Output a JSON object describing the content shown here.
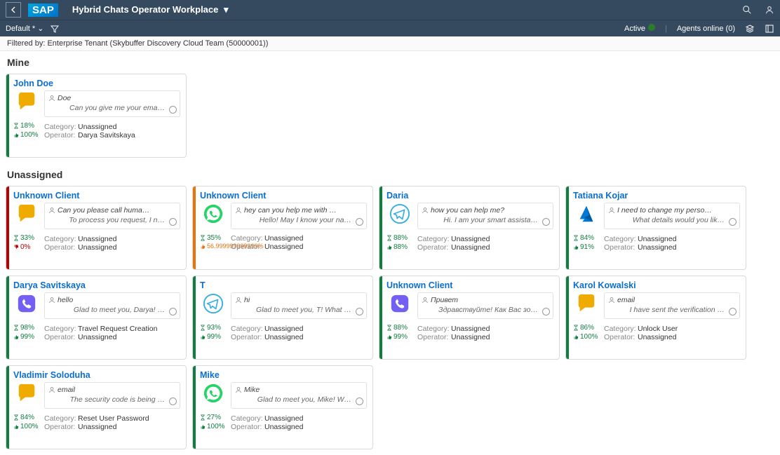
{
  "header": {
    "title": "Hybrid Chats Operator Workplace",
    "logoText": "SAP"
  },
  "subheader": {
    "default": "Default *",
    "activeLabel": "Active",
    "agentsOnline": "Agents online (0)"
  },
  "filter": "Filtered by: Enterprise Tenant (Skybuffer Discovery Cloud Team (50000001))",
  "sections": {
    "mine": "Mine",
    "unassigned": "Unassigned"
  },
  "labels": {
    "category": "Category:",
    "operator": "Operator:"
  },
  "mineCards": [
    {
      "title": "John Doe",
      "channel": "chat",
      "accent": "green",
      "msgUser": "Doe",
      "msgReply": "Can you give me your ema…",
      "timer": "18%",
      "timerClass": "stat-green",
      "thumb": "100%",
      "thumbClass": "stat-green",
      "thumbDir": "up",
      "category": "Unassigned",
      "operator": "Darya Savitskaya"
    }
  ],
  "unassignedCards": [
    {
      "title": "Unknown Client",
      "channel": "chat",
      "accent": "red",
      "msgUser": "Can you please call huma…",
      "msgReply": "To process you request, I n…",
      "timer": "33%",
      "timerClass": "stat-green",
      "thumb": "0%",
      "thumbClass": "stat-red",
      "thumbDir": "down",
      "category": "Unassigned",
      "operator": "Unassigned"
    },
    {
      "title": "Unknown Client",
      "channel": "whatsapp",
      "accent": "orange",
      "msgUser": "hey can you help me with …",
      "msgReply": "Hello! May I know your na…",
      "timer": "35%",
      "timerClass": "stat-green",
      "thumb": "56.999999999999%",
      "thumbClass": "stat-orange",
      "thumbDir": "up",
      "category": "Unassigned",
      "operator": "Unassigned"
    },
    {
      "title": "Daria",
      "channel": "telegram",
      "accent": "green",
      "msgUser": "how you can help me?",
      "msgReply": "Hi. I am your smart assista…",
      "timer": "88%",
      "timerClass": "stat-green",
      "thumb": "88%",
      "thumbClass": "stat-green",
      "thumbDir": "up",
      "category": "Unassigned",
      "operator": "Unassigned"
    },
    {
      "title": "Tatiana Kojar",
      "channel": "azure",
      "accent": "green",
      "msgUser": "I need to change my perso…",
      "msgReply": "What details would you lik…",
      "timer": "84%",
      "timerClass": "stat-green",
      "thumb": "91%",
      "thumbClass": "stat-green",
      "thumbDir": "up",
      "category": "Unassigned",
      "operator": "Unassigned"
    },
    {
      "title": "Darya Savitskaya",
      "channel": "viber",
      "accent": "green",
      "msgUser": "hello",
      "msgReply": "Glad to meet you, Darya! …",
      "timer": "98%",
      "timerClass": "stat-green",
      "thumb": "99%",
      "thumbClass": "stat-green",
      "thumbDir": "up",
      "category": "Travel Request Creation",
      "operator": "Unassigned"
    },
    {
      "title": "T",
      "channel": "telegram",
      "accent": "green",
      "msgUser": "hi",
      "msgReply": "Glad to meet you, T! What …",
      "timer": "93%",
      "timerClass": "stat-green",
      "thumb": "99%",
      "thumbClass": "stat-green",
      "thumbDir": "up",
      "category": "Unassigned",
      "operator": "Unassigned"
    },
    {
      "title": "Unknown Client",
      "channel": "viber",
      "accent": "green",
      "msgUser": "Привет",
      "msgReply": "Здравствуйте! Как Вас зо…",
      "timer": "88%",
      "timerClass": "stat-green",
      "thumb": "99%",
      "thumbClass": "stat-green",
      "thumbDir": "up",
      "category": "Unassigned",
      "operator": "Unassigned"
    },
    {
      "title": "Karol Kowalski",
      "channel": "chat",
      "accent": "green",
      "msgUser": "email",
      "msgReply": "I have sent the verification …",
      "timer": "86%",
      "timerClass": "stat-green",
      "thumb": "100%",
      "thumbClass": "stat-green",
      "thumbDir": "up",
      "category": "Unlock User",
      "operator": "Unassigned"
    },
    {
      "title": "Vladimir Soloduha",
      "channel": "chat",
      "accent": "green",
      "msgUser": "email",
      "msgReply": "The security code is being …",
      "timer": "84%",
      "timerClass": "stat-green",
      "thumb": "100%",
      "thumbClass": "stat-green",
      "thumbDir": "up",
      "category": "Reset User Password",
      "operator": "Unassigned"
    },
    {
      "title": "Mike",
      "channel": "whatsapp",
      "accent": "green",
      "msgUser": "Mike",
      "msgReply": "Glad to meet you, Mike! W…",
      "timer": "27%",
      "timerClass": "stat-green",
      "thumb": "100%",
      "thumbClass": "stat-green",
      "thumbDir": "up",
      "category": "Unassigned",
      "operator": "Unassigned"
    }
  ]
}
